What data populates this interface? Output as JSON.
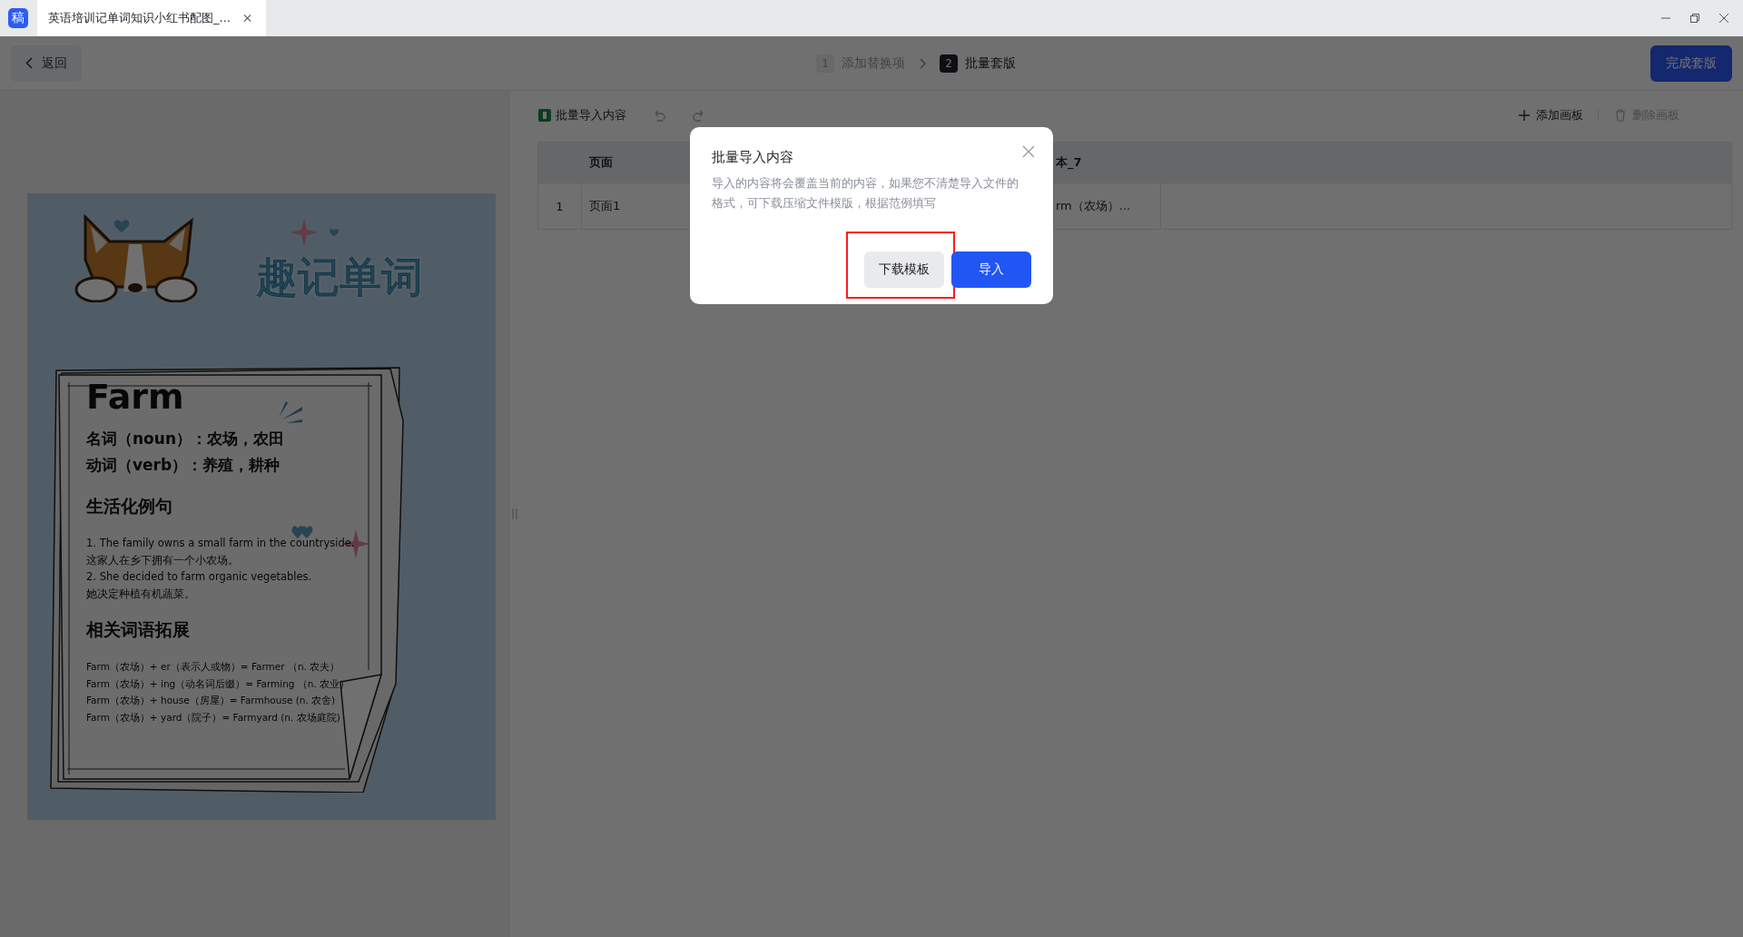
{
  "app_tab": {
    "icon_text": "稿",
    "title": "英语培训记单词知识小红书配图_..."
  },
  "header": {
    "back": "返回",
    "steps": [
      {
        "number": "1",
        "label": "添加替换项",
        "selected": false
      },
      {
        "number": "2",
        "label": "批量套版",
        "selected": true
      }
    ],
    "finish": "完成套版"
  },
  "poster": {
    "title": "趣记单词",
    "word": "Farm",
    "definitions": [
      "名词（noun）：农场，农田",
      "动词（verb）：养殖，耕种"
    ],
    "sections": [
      {
        "heading": "生活化例句",
        "kind": "sentences",
        "lines": [
          "1. The family owns a small farm in the countryside.",
          "这家人在乡下拥有一个小农场。",
          "2. She decided to farm organic vegetables.",
          "她决定种植有机蔬菜。"
        ]
      },
      {
        "heading": "相关词语拓展",
        "kind": "expansions",
        "lines": [
          "Farm（农场）+ er（表示人或物）= Farmer （n. 农夫）",
          "Farm（农场）+ ing（动名词后缀）= Farming （n. 农业）",
          "Farm（农场）+ house（房屋）= Farmhouse (n. 农舍)",
          "Farm（农场）+ yard（院子）= Farmyard (n. 农场庭院)"
        ]
      }
    ]
  },
  "toolbar": {
    "import": "批量导入内容",
    "actions": [
      {
        "kind": "add",
        "label": "添加画板",
        "disabled": false
      },
      {
        "kind": "delete",
        "label": "删除画板",
        "disabled": true
      }
    ]
  },
  "table": {
    "columns": [
      {
        "label": "页面"
      },
      {
        "label": "本_7"
      }
    ],
    "rows": [
      {
        "index": "1",
        "cells": [
          "页面1",
          "rm（农场）..."
        ]
      }
    ]
  },
  "dialog": {
    "title": "批量导入内容",
    "message": "导入的内容将会覆盖当前的内容，如果您不清楚导入文件的格式，可下载压缩文件模版，根据范例填写",
    "buttons": [
      {
        "kind": "secondary",
        "label": "下载模板",
        "highlighted": true
      },
      {
        "kind": "primary",
        "label": "导入",
        "highlighted": false
      }
    ]
  }
}
